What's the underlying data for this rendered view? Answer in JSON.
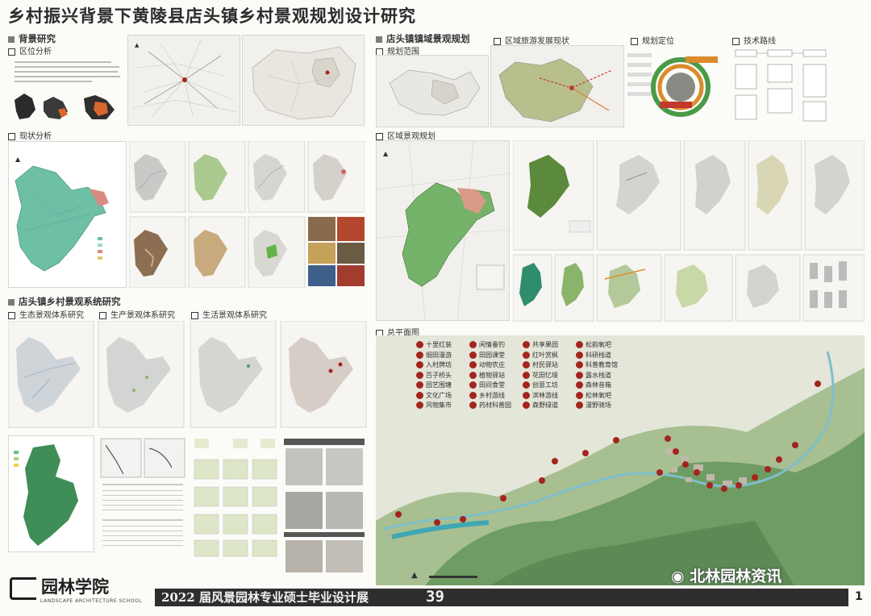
{
  "title": "乡村振兴背景下黄陵县店头镇乡村景观规划设计研究",
  "sections": {
    "background": "背景研究",
    "location": "区位分析",
    "status": "现状分析",
    "village_system": "店头镇乡村景观系统研究",
    "eco": "生态景观体系研究",
    "production": "生产景观体系研究",
    "living": "生活景观体系研究",
    "town_planning": "店头镇镇域景观规划",
    "scope": "规划范围",
    "tourism": "区域旅游发展现状",
    "positioning": "规划定位",
    "tech_route": "技术路线",
    "regional": "区域景观规划",
    "master_plan": "总平面图"
  },
  "master_plan_legend": [
    [
      "十里红装",
      "闲情垂钓",
      "共享果园",
      "松韵氧吧"
    ],
    [
      "烟田漫游",
      "田园课堂",
      "红叶赏枫",
      "科研栈道"
    ],
    [
      "入村牌坊",
      "动物农庄",
      "村民驿站",
      "科普教育馆"
    ],
    [
      "百子桥头",
      "植物驿站",
      "花田忆境",
      "露水栈道"
    ],
    [
      "园艺围塘",
      "田间食堂",
      "创意工坊",
      "森林音箱"
    ],
    [
      "文化广场",
      "乡村游线",
      "滨林游线",
      "松林氧吧"
    ],
    [
      "风物集市",
      "药材科普园",
      "森野绿道",
      "漫野骑场"
    ]
  ],
  "colors": {
    "accent_red": "#a4241e",
    "footer_dark": "#2e2e2e",
    "forest_green": "#5f8a58",
    "teal": "#3f9b8c"
  },
  "footer": {
    "logo": "园林学院",
    "logo_sub": "LANDSCAPE ARCHITECTURE SCHOOL",
    "exhibition": "2022 届风景园林专业硕士毕业设计展",
    "page_number": "39",
    "side_number": "1",
    "watermark": "北林园林资讯"
  }
}
